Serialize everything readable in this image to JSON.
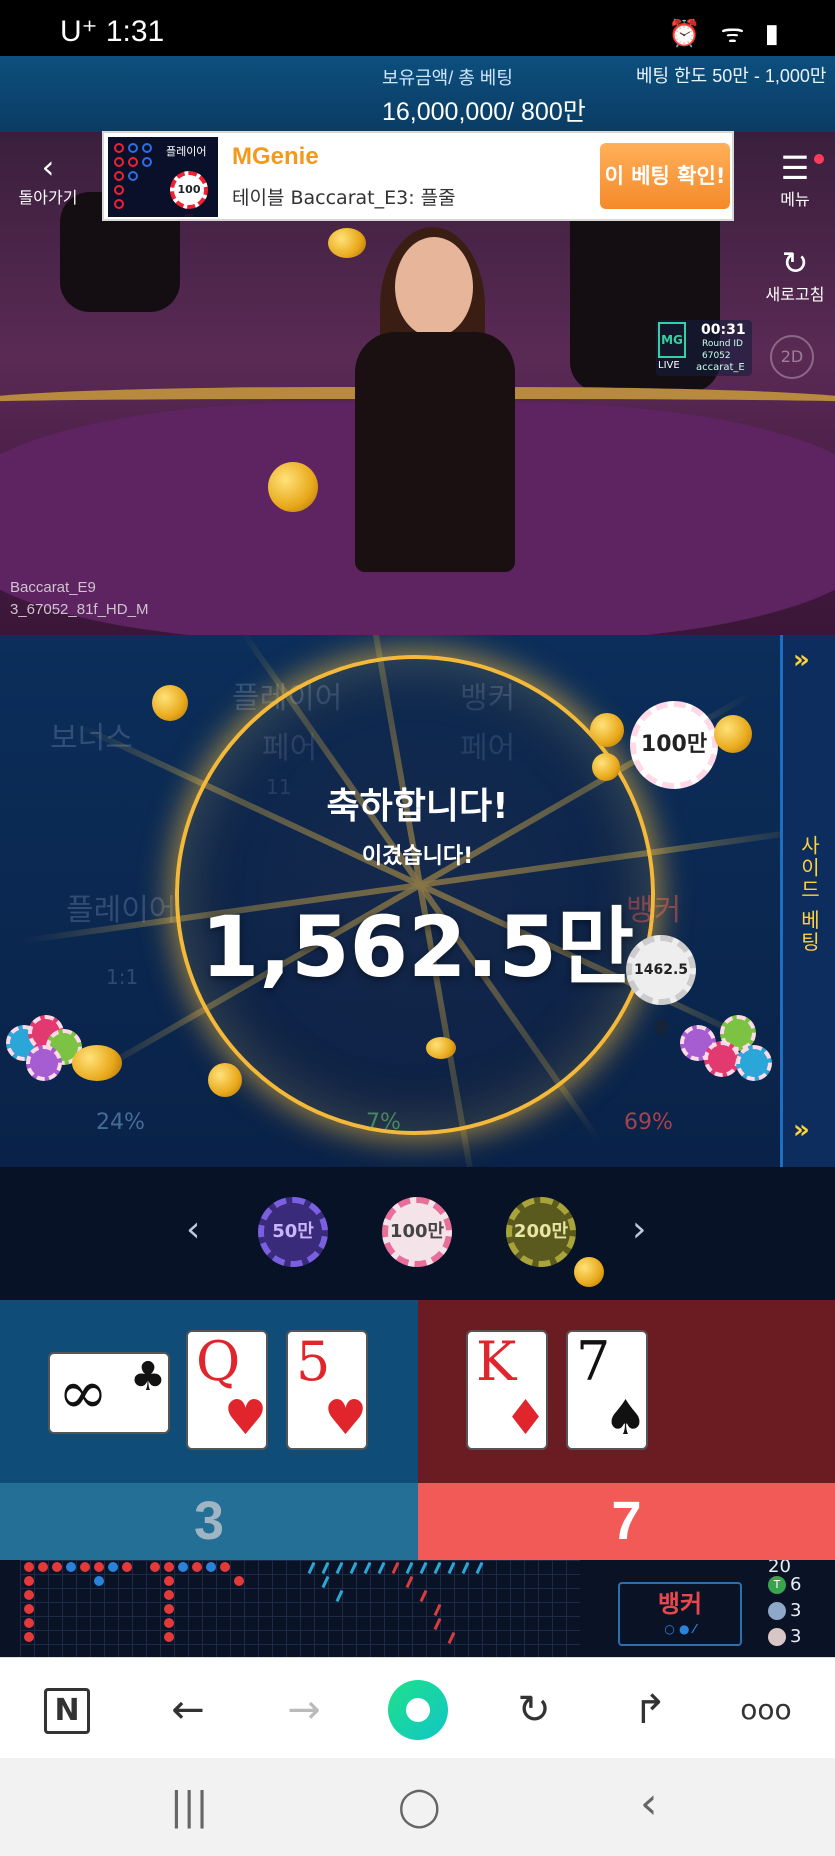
{
  "status_bar": {
    "carrier_time": "U⁺ 1:31",
    "right_icons": "⏰ ᯤ ▮"
  },
  "top_bar": {
    "balance_label": "보유금액/ 총 베팅",
    "balance_value": "16,000,000/ 800만",
    "bet_limit": "베팅 한도 50만 - 1,000만"
  },
  "nav": {
    "back_label": "돌아가기",
    "menu_label": "메뉴",
    "refresh_label": "새로고침"
  },
  "ad": {
    "thumb_label": "플레이어",
    "thumb_chip": "100만",
    "title": "MGenie",
    "subtitle": "테이블 Baccarat_E3: 플줄",
    "cta": "이 베팅 확인!"
  },
  "stream": {
    "logo_text": "MG",
    "live_label": "LIVE",
    "timer": "00:31",
    "round_id": "Round ID 67052",
    "account": "accarat_E",
    "view_2d": "2D",
    "video_label_line1": "Baccarat_E9",
    "video_label_line2": "3_67052_81f_HD_M"
  },
  "bet_board": {
    "bonus": "보너스",
    "player_pair_l1": "플레이어",
    "player_pair_l2": "페어",
    "banker_pair_l1": "뱅커",
    "banker_pair_l2": "페어",
    "pair_odds": "11",
    "player": "플레이어",
    "player_odds": "1:1",
    "banker": "뱅커",
    "player_pct": "24%",
    "tie_pct": "7%",
    "banker_pct": "69%",
    "side_bet_label": "사이드 베팅",
    "side_arrow_top": "»",
    "side_arrow_bottom": "»",
    "chip_100": "100만",
    "chip_banker": "1462.5만"
  },
  "win_overlay": {
    "title": "축하합니다!",
    "subtitle": "이겼습니다!",
    "amount": "1,562.5만"
  },
  "chip_selector": {
    "prev": "‹",
    "next": "›",
    "chips": [
      "50만",
      "100만",
      "200만"
    ]
  },
  "hands": {
    "player_cards": [
      {
        "rank": "∞",
        "suit": "♣"
      },
      {
        "rank": "Q",
        "suit": "♥"
      },
      {
        "rank": "5",
        "suit": "♥"
      }
    ],
    "banker_cards": [
      {
        "rank": "K",
        "suit": "♦"
      },
      {
        "rank": "7",
        "suit": "♠"
      }
    ],
    "player_score": "3",
    "banker_score": "7"
  },
  "road": {
    "banker_button": "뱅커",
    "stat_top": "20",
    "stat_tie": "6",
    "stat_pp": "3",
    "stat_bp": "3",
    "tie_icon": "T"
  },
  "browser": {
    "n_label": "N",
    "back": "←",
    "forward": "→",
    "reload": "↻",
    "share": "↱",
    "more": "ooo"
  },
  "android_nav": {
    "recent": "|||",
    "home": "◯",
    "back": "‹"
  },
  "colors": {
    "gold": "#f5b93a",
    "player_blue": "#0f4c78",
    "banker_red": "#6b1c22",
    "ad_orange": "#f39a1b"
  }
}
